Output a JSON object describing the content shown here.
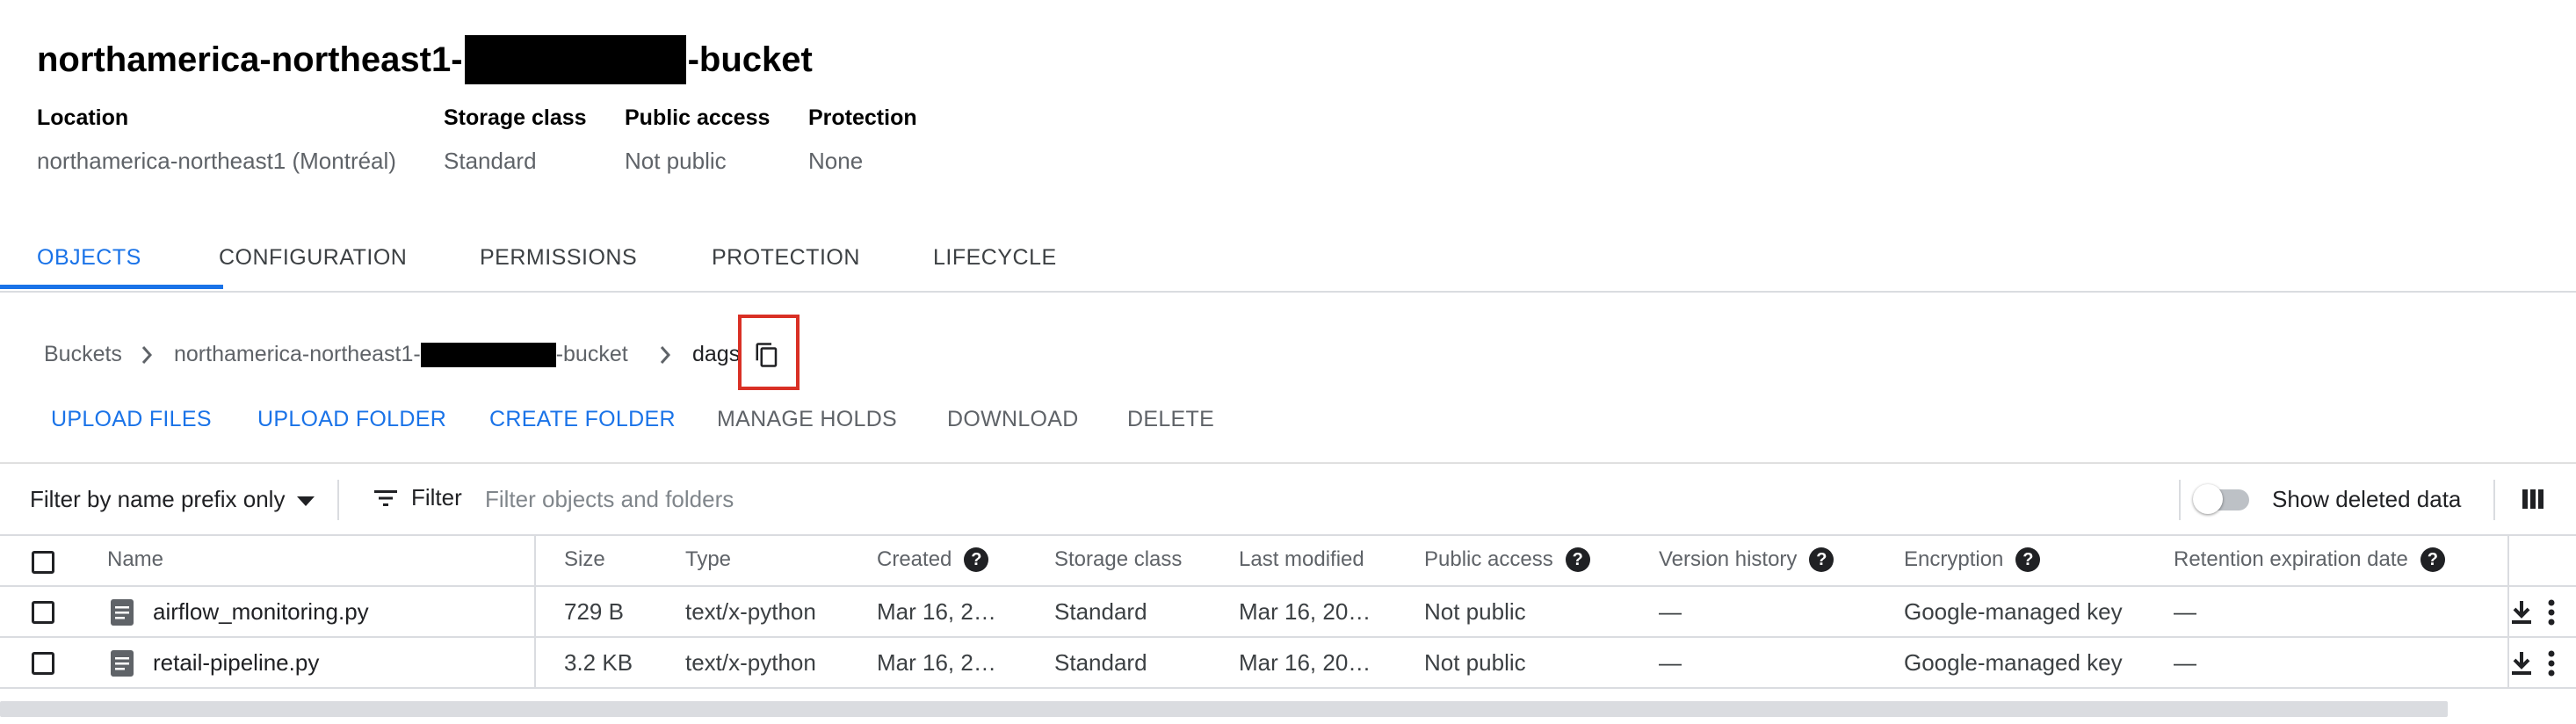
{
  "bucket": {
    "title_prefix": "northamerica-northeast1-",
    "title_suffix": "-bucket"
  },
  "meta": [
    {
      "label": "Location",
      "value": "northamerica-northeast1 (Montréal)"
    },
    {
      "label": "Storage class",
      "value": "Standard"
    },
    {
      "label": "Public access",
      "value": "Not public"
    },
    {
      "label": "Protection",
      "value": "None"
    }
  ],
  "tabs": [
    {
      "label": "OBJECTS",
      "active": true
    },
    {
      "label": "CONFIGURATION"
    },
    {
      "label": "PERMISSIONS"
    },
    {
      "label": "PROTECTION"
    },
    {
      "label": "LIFECYCLE"
    }
  ],
  "breadcrumb": {
    "root": "Buckets",
    "bucket_prefix": "northamerica-northeast1-",
    "bucket_suffix": "-bucket",
    "current": "dags"
  },
  "actions": [
    {
      "label": "UPLOAD FILES",
      "enabled": true
    },
    {
      "label": "UPLOAD FOLDER",
      "enabled": true
    },
    {
      "label": "CREATE FOLDER",
      "enabled": true
    },
    {
      "label": "MANAGE HOLDS",
      "enabled": false
    },
    {
      "label": "DOWNLOAD",
      "enabled": false
    },
    {
      "label": "DELETE",
      "enabled": false
    }
  ],
  "filter": {
    "prefix_mode": "Filter by name prefix only",
    "button_label": "Filter",
    "placeholder": "Filter objects and folders",
    "show_deleted_label": "Show deleted data",
    "show_deleted_on": false
  },
  "table": {
    "headers": {
      "name": "Name",
      "size": "Size",
      "type": "Type",
      "created": "Created",
      "storage_class": "Storage class",
      "last_modified": "Last modified",
      "public_access": "Public access",
      "version_history": "Version history",
      "encryption": "Encryption",
      "retention": "Retention expiration date"
    },
    "rows": [
      {
        "name": "airflow_monitoring.py",
        "size": "729 B",
        "type": "text/x-python",
        "created": "Mar 16, 2…",
        "storage_class": "Standard",
        "last_modified": "Mar 16, 20…",
        "public_access": "Not public",
        "version_history": "—",
        "encryption": "Google-managed key",
        "retention": "—"
      },
      {
        "name": "retail-pipeline.py",
        "size": "3.2 KB",
        "type": "text/x-python",
        "created": "Mar 16, 2…",
        "storage_class": "Standard",
        "last_modified": "Mar 16, 20…",
        "public_access": "Not public",
        "version_history": "—",
        "encryption": "Google-managed key",
        "retention": "—"
      }
    ]
  },
  "colors": {
    "accent": "#1a73e8",
    "highlight": "#d93025"
  }
}
